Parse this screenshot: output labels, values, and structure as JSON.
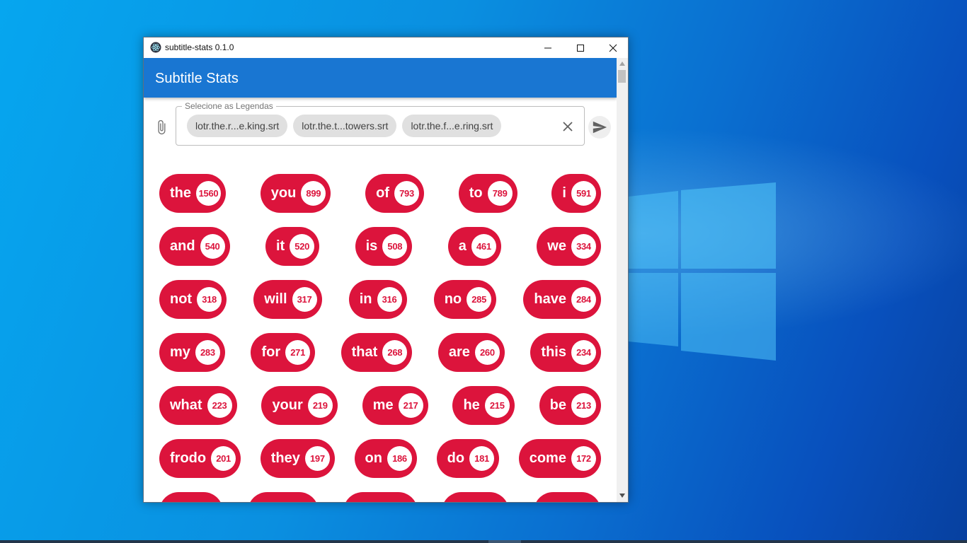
{
  "window": {
    "title": "subtitle-stats 0.1.0"
  },
  "appbar": {
    "title": "Subtitle Stats"
  },
  "file_selector": {
    "legend": "Selecione as Legendas",
    "files": [
      "lotr.the.r...e.king.srt",
      "lotr.the.t...towers.srt",
      "lotr.the.f...e.ring.srt"
    ]
  },
  "colors": {
    "appbar": "#1976d2",
    "word_chip": "#dc143c",
    "desktop": "#0a8fe0"
  },
  "words": [
    [
      {
        "word": "the",
        "count": "1560"
      },
      {
        "word": "you",
        "count": "899"
      },
      {
        "word": "of",
        "count": "793"
      },
      {
        "word": "to",
        "count": "789"
      },
      {
        "word": "i",
        "count": "591"
      }
    ],
    [
      {
        "word": "and",
        "count": "540"
      },
      {
        "word": "it",
        "count": "520"
      },
      {
        "word": "is",
        "count": "508"
      },
      {
        "word": "a",
        "count": "461"
      },
      {
        "word": "we",
        "count": "334"
      }
    ],
    [
      {
        "word": "not",
        "count": "318"
      },
      {
        "word": "will",
        "count": "317"
      },
      {
        "word": "in",
        "count": "316"
      },
      {
        "word": "no",
        "count": "285"
      },
      {
        "word": "have",
        "count": "284"
      }
    ],
    [
      {
        "word": "my",
        "count": "283"
      },
      {
        "word": "for",
        "count": "271"
      },
      {
        "word": "that",
        "count": "268"
      },
      {
        "word": "are",
        "count": "260"
      },
      {
        "word": "this",
        "count": "234"
      }
    ],
    [
      {
        "word": "what",
        "count": "223"
      },
      {
        "word": "your",
        "count": "219"
      },
      {
        "word": "me",
        "count": "217"
      },
      {
        "word": "he",
        "count": "215"
      },
      {
        "word": "be",
        "count": "213"
      }
    ],
    [
      {
        "word": "frodo",
        "count": "201"
      },
      {
        "word": "they",
        "count": "197"
      },
      {
        "word": "on",
        "count": "186"
      },
      {
        "word": "do",
        "count": "181"
      },
      {
        "word": "come",
        "count": "172"
      }
    ]
  ]
}
